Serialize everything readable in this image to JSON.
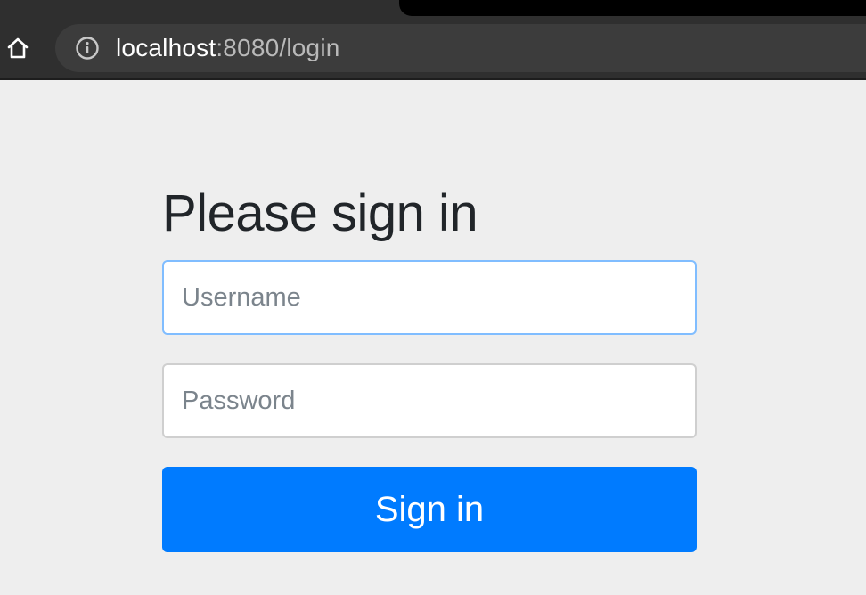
{
  "browser": {
    "url_host": "localhost",
    "url_rest": ":8080/login",
    "home_icon": "home-icon",
    "info_icon": "info-icon"
  },
  "login": {
    "heading": "Please sign in",
    "username_placeholder": "Username",
    "password_placeholder": "Password",
    "submit_label": "Sign in"
  },
  "colors": {
    "page_background": "#eeeeee",
    "chrome_background": "#2f2f2f",
    "primary_button": "#007bff",
    "focus_border": "#80bdff"
  }
}
